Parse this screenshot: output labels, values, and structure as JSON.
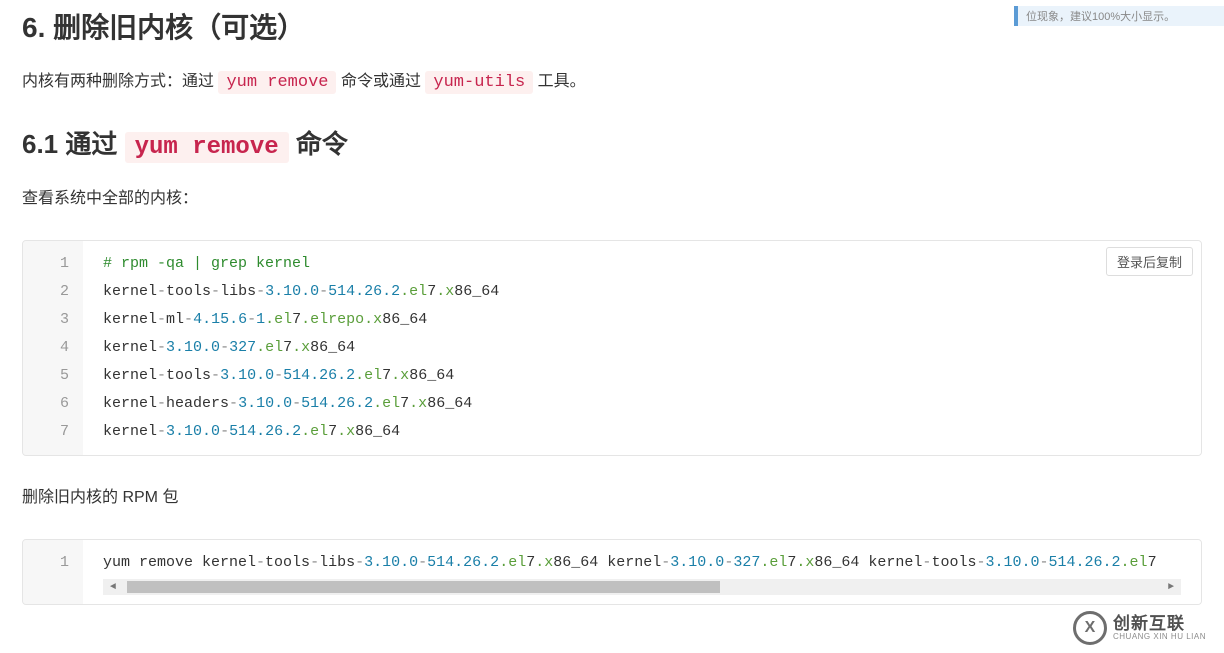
{
  "notice_partial": "位现象，建议100%大小显示。",
  "section": {
    "title": "6.  删除旧内核（可选）",
    "intro_prefix": "内核有两种删除方式：通过 ",
    "intro_code1": "yum remove",
    "intro_mid": " 命令或通过 ",
    "intro_code2": "yum-utils",
    "intro_suffix": " 工具。"
  },
  "subsection": {
    "title_prefix": "6.1  通过 ",
    "title_code": "yum remove",
    "title_suffix": " 命令",
    "lead": "查看系统中全部的内核："
  },
  "copy_label": "登录后复制",
  "code1": {
    "lines": [
      [
        {
          "t": "# rpm -qa | grep kernel",
          "c": "tok-comment"
        }
      ],
      [
        {
          "t": "kernel",
          "c": "tok-plain"
        },
        {
          "t": "-",
          "c": "tok-punct"
        },
        {
          "t": "tools",
          "c": "tok-plain"
        },
        {
          "t": "-",
          "c": "tok-punct"
        },
        {
          "t": "libs",
          "c": "tok-plain"
        },
        {
          "t": "-",
          "c": "tok-punct"
        },
        {
          "t": "3.10",
          "c": "tok-num"
        },
        {
          "t": ".0",
          "c": "tok-num"
        },
        {
          "t": "-",
          "c": "tok-punct"
        },
        {
          "t": "514.26",
          "c": "tok-num"
        },
        {
          "t": ".2",
          "c": "tok-num"
        },
        {
          "t": ".el",
          "c": "tok-kw"
        },
        {
          "t": "7",
          "c": "tok-plain"
        },
        {
          "t": ".x",
          "c": "tok-kw"
        },
        {
          "t": "86_64",
          "c": "tok-plain"
        }
      ],
      [
        {
          "t": "kernel",
          "c": "tok-plain"
        },
        {
          "t": "-",
          "c": "tok-punct"
        },
        {
          "t": "ml",
          "c": "tok-plain"
        },
        {
          "t": "-",
          "c": "tok-punct"
        },
        {
          "t": "4.15",
          "c": "tok-num"
        },
        {
          "t": ".6",
          "c": "tok-num"
        },
        {
          "t": "-",
          "c": "tok-punct"
        },
        {
          "t": "1",
          "c": "tok-num"
        },
        {
          "t": ".el",
          "c": "tok-kw"
        },
        {
          "t": "7",
          "c": "tok-plain"
        },
        {
          "t": ".elrepo",
          "c": "tok-kw"
        },
        {
          "t": ".x",
          "c": "tok-kw"
        },
        {
          "t": "86_64",
          "c": "tok-plain"
        }
      ],
      [
        {
          "t": "kernel",
          "c": "tok-plain"
        },
        {
          "t": "-",
          "c": "tok-punct"
        },
        {
          "t": "3.10",
          "c": "tok-num"
        },
        {
          "t": ".0",
          "c": "tok-num"
        },
        {
          "t": "-",
          "c": "tok-punct"
        },
        {
          "t": "327",
          "c": "tok-num"
        },
        {
          "t": ".el",
          "c": "tok-kw"
        },
        {
          "t": "7",
          "c": "tok-plain"
        },
        {
          "t": ".x",
          "c": "tok-kw"
        },
        {
          "t": "86_64",
          "c": "tok-plain"
        }
      ],
      [
        {
          "t": "kernel",
          "c": "tok-plain"
        },
        {
          "t": "-",
          "c": "tok-punct"
        },
        {
          "t": "tools",
          "c": "tok-plain"
        },
        {
          "t": "-",
          "c": "tok-punct"
        },
        {
          "t": "3.10",
          "c": "tok-num"
        },
        {
          "t": ".0",
          "c": "tok-num"
        },
        {
          "t": "-",
          "c": "tok-punct"
        },
        {
          "t": "514.26",
          "c": "tok-num"
        },
        {
          "t": ".2",
          "c": "tok-num"
        },
        {
          "t": ".el",
          "c": "tok-kw"
        },
        {
          "t": "7",
          "c": "tok-plain"
        },
        {
          "t": ".x",
          "c": "tok-kw"
        },
        {
          "t": "86_64",
          "c": "tok-plain"
        }
      ],
      [
        {
          "t": "kernel",
          "c": "tok-plain"
        },
        {
          "t": "-",
          "c": "tok-punct"
        },
        {
          "t": "headers",
          "c": "tok-plain"
        },
        {
          "t": "-",
          "c": "tok-punct"
        },
        {
          "t": "3.10",
          "c": "tok-num"
        },
        {
          "t": ".0",
          "c": "tok-num"
        },
        {
          "t": "-",
          "c": "tok-punct"
        },
        {
          "t": "514.26",
          "c": "tok-num"
        },
        {
          "t": ".2",
          "c": "tok-num"
        },
        {
          "t": ".el",
          "c": "tok-kw"
        },
        {
          "t": "7",
          "c": "tok-plain"
        },
        {
          "t": ".x",
          "c": "tok-kw"
        },
        {
          "t": "86_64",
          "c": "tok-plain"
        }
      ],
      [
        {
          "t": "kernel",
          "c": "tok-plain"
        },
        {
          "t": "-",
          "c": "tok-punct"
        },
        {
          "t": "3.10",
          "c": "tok-num"
        },
        {
          "t": ".0",
          "c": "tok-num"
        },
        {
          "t": "-",
          "c": "tok-punct"
        },
        {
          "t": "514.26",
          "c": "tok-num"
        },
        {
          "t": ".2",
          "c": "tok-num"
        },
        {
          "t": ".el",
          "c": "tok-kw"
        },
        {
          "t": "7",
          "c": "tok-plain"
        },
        {
          "t": ".x",
          "c": "tok-kw"
        },
        {
          "t": "86_64",
          "c": "tok-plain"
        }
      ]
    ]
  },
  "mid_text": "删除旧内核的 RPM 包",
  "code2": {
    "lines": [
      [
        {
          "t": "yum remove kernel",
          "c": "tok-plain"
        },
        {
          "t": "-",
          "c": "tok-punct"
        },
        {
          "t": "tools",
          "c": "tok-plain"
        },
        {
          "t": "-",
          "c": "tok-punct"
        },
        {
          "t": "libs",
          "c": "tok-plain"
        },
        {
          "t": "-",
          "c": "tok-punct"
        },
        {
          "t": "3.10",
          "c": "tok-num"
        },
        {
          "t": ".0",
          "c": "tok-num"
        },
        {
          "t": "-",
          "c": "tok-punct"
        },
        {
          "t": "514.26",
          "c": "tok-num"
        },
        {
          "t": ".2",
          "c": "tok-num"
        },
        {
          "t": ".el",
          "c": "tok-kw"
        },
        {
          "t": "7",
          "c": "tok-plain"
        },
        {
          "t": ".x",
          "c": "tok-kw"
        },
        {
          "t": "86_64 kernel",
          "c": "tok-plain"
        },
        {
          "t": "-",
          "c": "tok-punct"
        },
        {
          "t": "3.10",
          "c": "tok-num"
        },
        {
          "t": ".0",
          "c": "tok-num"
        },
        {
          "t": "-",
          "c": "tok-punct"
        },
        {
          "t": "327",
          "c": "tok-num"
        },
        {
          "t": ".el",
          "c": "tok-kw"
        },
        {
          "t": "7",
          "c": "tok-plain"
        },
        {
          "t": ".x",
          "c": "tok-kw"
        },
        {
          "t": "86_64 kernel",
          "c": "tok-plain"
        },
        {
          "t": "-",
          "c": "tok-punct"
        },
        {
          "t": "tools",
          "c": "tok-plain"
        },
        {
          "t": "-",
          "c": "tok-punct"
        },
        {
          "t": "3.10",
          "c": "tok-num"
        },
        {
          "t": ".0",
          "c": "tok-num"
        },
        {
          "t": "-",
          "c": "tok-punct"
        },
        {
          "t": "514.26",
          "c": "tok-num"
        },
        {
          "t": ".2",
          "c": "tok-num"
        },
        {
          "t": ".el",
          "c": "tok-kw"
        },
        {
          "t": "7",
          "c": "tok-plain"
        }
      ]
    ]
  },
  "logo": {
    "cn": "创新互联",
    "en": "CHUANG XIN HU LIAN",
    "mark": "X"
  }
}
